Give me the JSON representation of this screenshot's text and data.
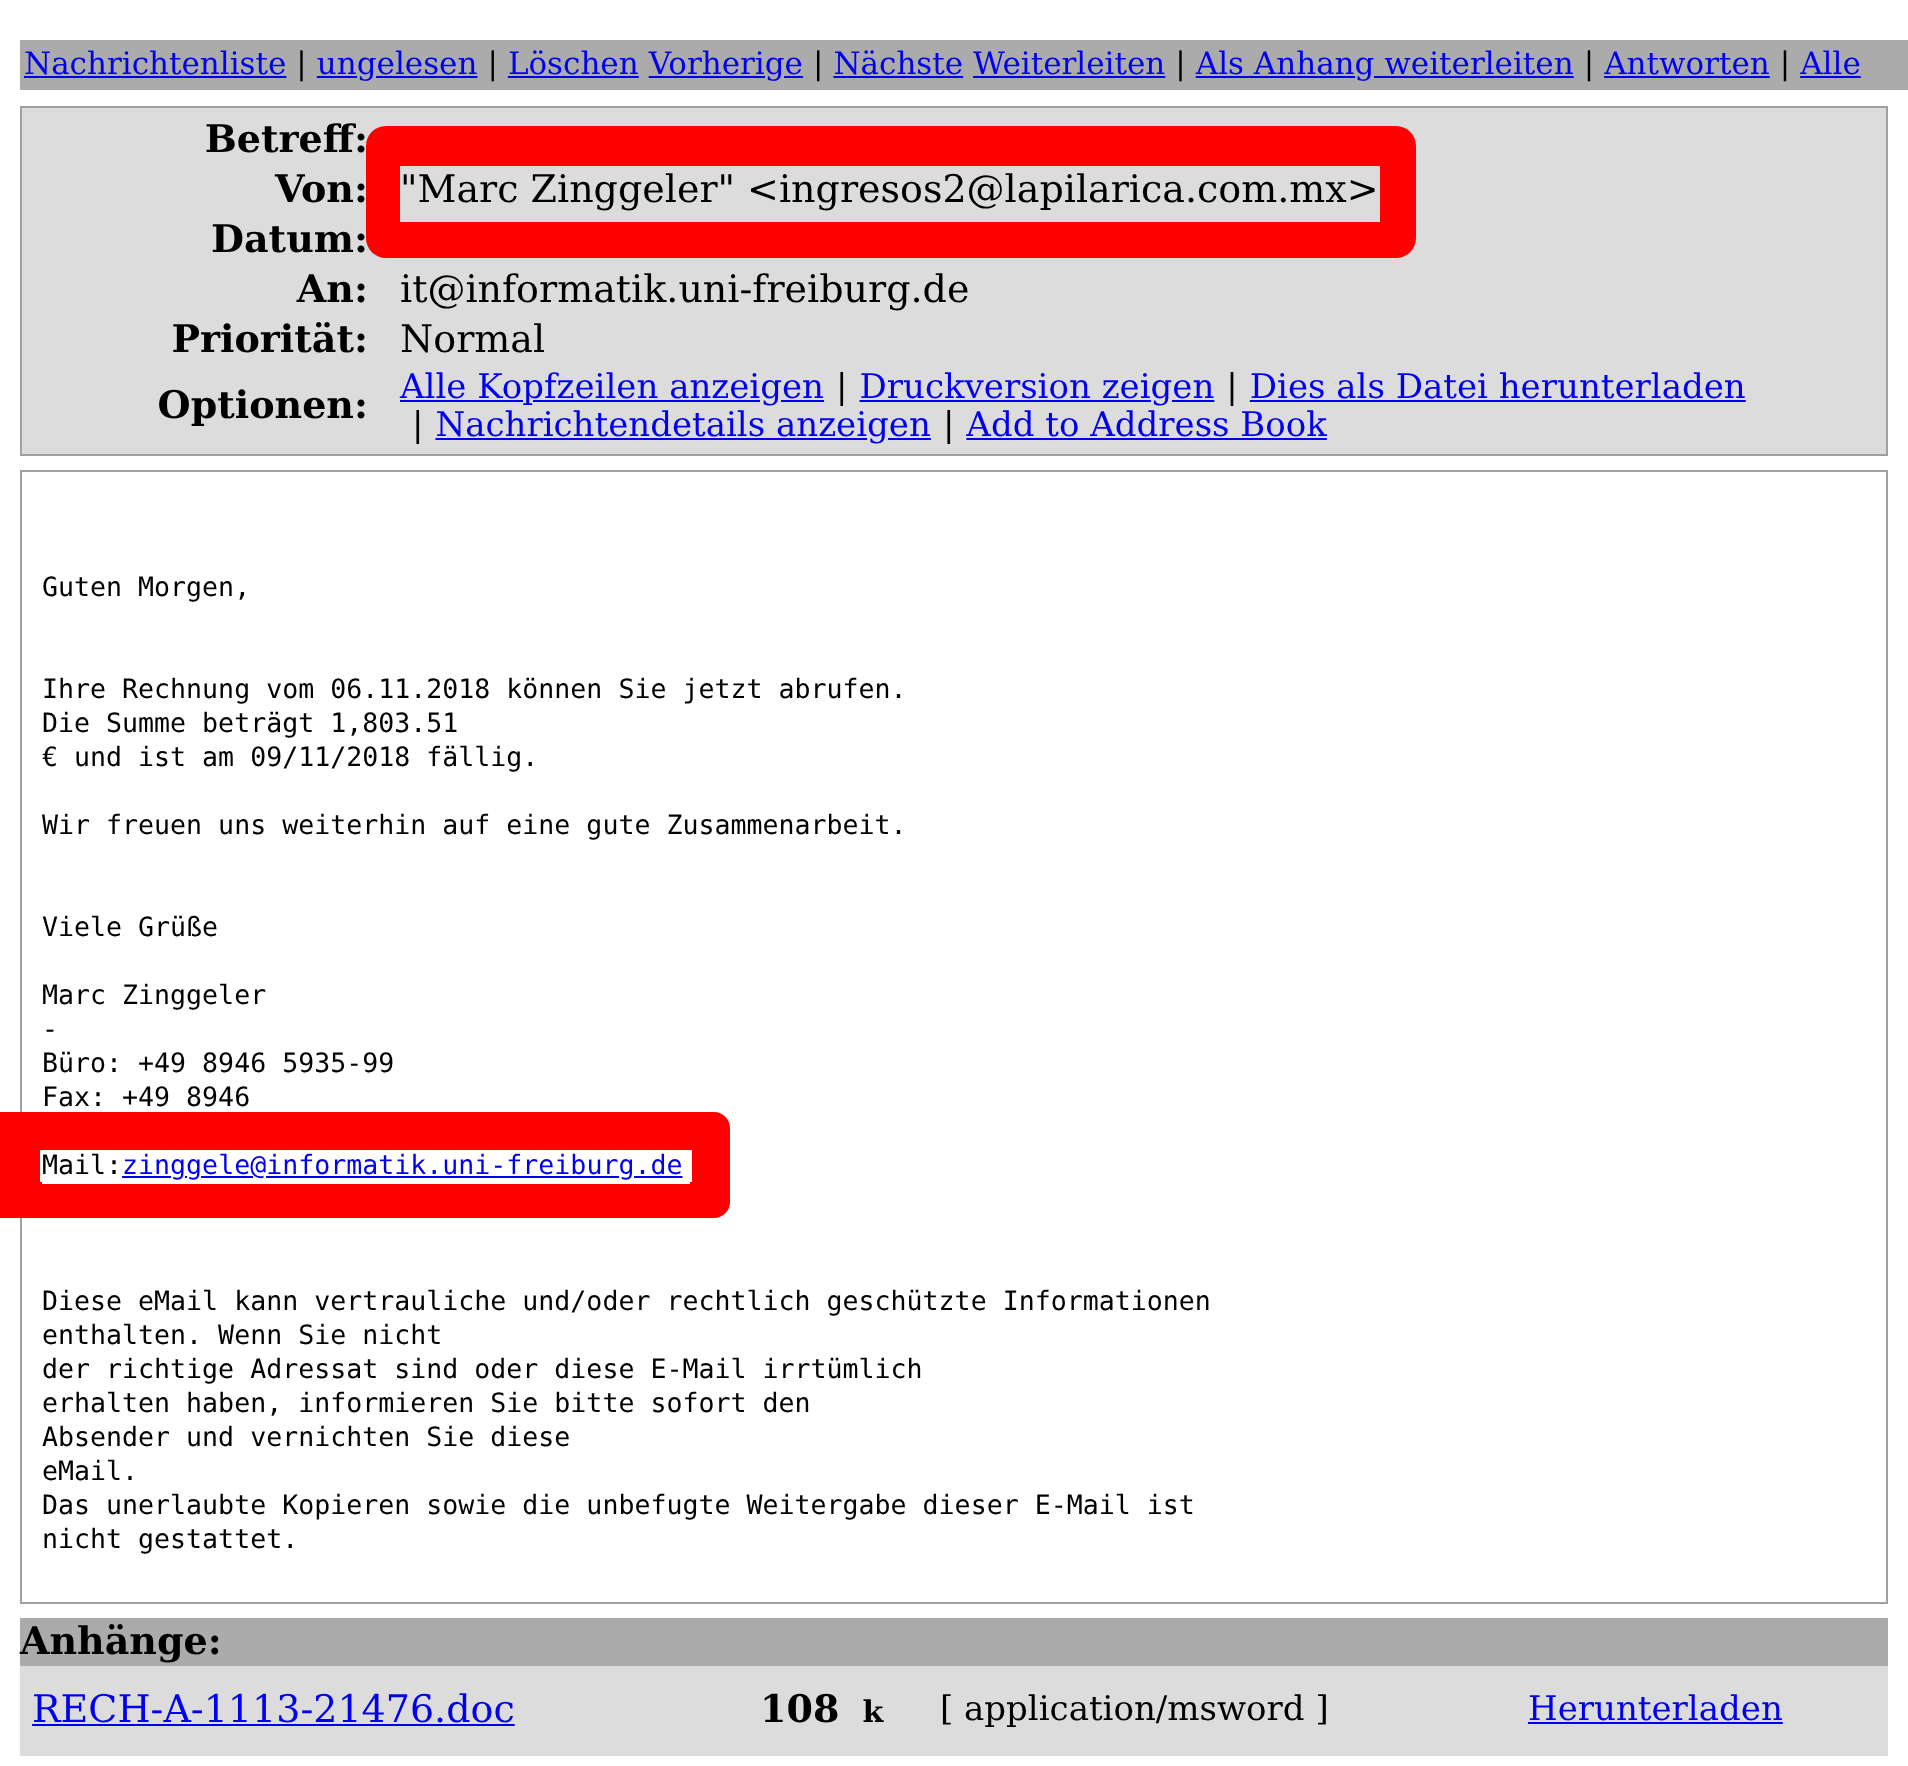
{
  "nav": [
    {
      "kind": "link",
      "text": "Nachrichtenliste"
    },
    {
      "kind": "sep",
      "text": "|"
    },
    {
      "kind": "link",
      "text": "ungelesen"
    },
    {
      "kind": "sep",
      "text": "|"
    },
    {
      "kind": "link",
      "text": "Löschen"
    },
    {
      "kind": "link",
      "text": "Vorherige"
    },
    {
      "kind": "sep",
      "text": "|"
    },
    {
      "kind": "link",
      "text": "Nächste"
    },
    {
      "kind": "link",
      "text": "Weiterleiten"
    },
    {
      "kind": "sep",
      "text": "|"
    },
    {
      "kind": "link",
      "text": "Als Anhang weiterleiten"
    },
    {
      "kind": "sep",
      "text": "|"
    },
    {
      "kind": "link",
      "text": "Antworten"
    },
    {
      "kind": "sep",
      "text": "|"
    },
    {
      "kind": "link",
      "text": "Alle"
    }
  ],
  "header": [
    {
      "label": "Betreff:",
      "highlighted": false
    },
    {
      "label": "Von:",
      "value": "\"Marc Zinggeler\" <ingresos2@lapilarica.com.mx>",
      "highlighted": true
    },
    {
      "label": "Datum:",
      "highlighted": false
    },
    {
      "label": "An:",
      "value": "it@informatik.uni-freiburg.de",
      "highlighted": false
    },
    {
      "label": "Priorität:",
      "value": "Normal",
      "highlighted": false
    }
  ],
  "options": {
    "label": "Optionen:",
    "items": [
      {
        "kind": "link",
        "text": "Alle Kopfzeilen anzeigen"
      },
      {
        "kind": "sep",
        "text": "|"
      },
      {
        "kind": "link",
        "text": "Druckversion zeigen"
      },
      {
        "kind": "sep",
        "text": "|"
      },
      {
        "kind": "link",
        "text": "Dies als Datei herunterladen"
      },
      {
        "kind": "break"
      },
      {
        "kind": "sep",
        "text": "|"
      },
      {
        "kind": "link",
        "text": "Nachrichtendetails anzeigen"
      },
      {
        "kind": "sep",
        "text": "|"
      },
      {
        "kind": "link",
        "text": "Add to Address Book"
      }
    ]
  },
  "body": {
    "text_before": "Guten Morgen,\n\n\nIhre Rechnung vom 06.11.2018 können Sie jetzt abrufen.\nDie Summe beträgt 1,803.51\n€ und ist am 09/11/2018 fällig.\n\nWir freuen uns weiterhin auf eine gute Zusammenarbeit.\n\n\nViele Grüße\n\nMarc Zinggeler\n-\nBüro: +49 8946 5935-99\nFax: +49 8946",
    "mail_line": {
      "prefix": "Mail:",
      "link": "zinggele@informatik.uni-freiburg.de",
      "highlighted": true
    },
    "text_after": "Diese eMail kann vertrauliche und/oder rechtlich geschützte Informationen\nenthalten. Wenn Sie nicht\nder richtige Adressat sind oder diese E-Mail irrtümlich\nerhalten haben, informieren Sie bitte sofort den\nAbsender und vernichten Sie diese\neMail.\nDas unerlaubte Kopieren sowie die unbefugte Weitergabe dieser E-Mail ist\nnicht gestattet."
  },
  "attachments": {
    "title": "Anhänge:",
    "items": [
      {
        "filename": "RECH-A-1113-21476.doc",
        "size": "108",
        "unit": "k",
        "type": "[ application/msword ]",
        "action": "Herunterladen"
      }
    ]
  }
}
